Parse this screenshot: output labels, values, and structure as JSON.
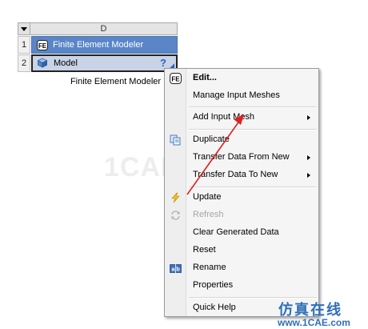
{
  "system": {
    "column_header": "D",
    "rows": [
      {
        "num": "1",
        "label": "Finite Element Modeler"
      },
      {
        "num": "2",
        "label": "Model",
        "status": "?"
      }
    ],
    "caption": "Finite Element Modeler"
  },
  "context_menu": {
    "items": [
      {
        "label": "Edit...",
        "bold": true,
        "icon": "fe-icon"
      },
      {
        "label": "Manage Input Meshes"
      },
      {
        "label": "Add Input Mesh",
        "submenu": true
      },
      {
        "label": "Duplicate",
        "icon": "duplicate-icon"
      },
      {
        "label": "Transfer Data From New",
        "submenu": true
      },
      {
        "label": "Transfer Data To New",
        "submenu": true
      },
      {
        "label": "Update",
        "icon": "lightning-icon"
      },
      {
        "label": "Refresh",
        "icon": "refresh-icon",
        "disabled": true
      },
      {
        "label": "Clear Generated Data"
      },
      {
        "label": "Reset"
      },
      {
        "label": "Rename",
        "icon": "rename-icon"
      },
      {
        "label": "Properties"
      },
      {
        "label": "Quick Help"
      }
    ]
  },
  "watermark": {
    "center": "1CAE.COM",
    "brand": "仿真在线",
    "url": "www.1CAE.com"
  },
  "colors": {
    "row_title_bg": "#5a86c8",
    "row_model_bg": "#c8d3e6",
    "annotation_arrow": "#e02020",
    "watermark_blue": "#2f6fb7"
  }
}
